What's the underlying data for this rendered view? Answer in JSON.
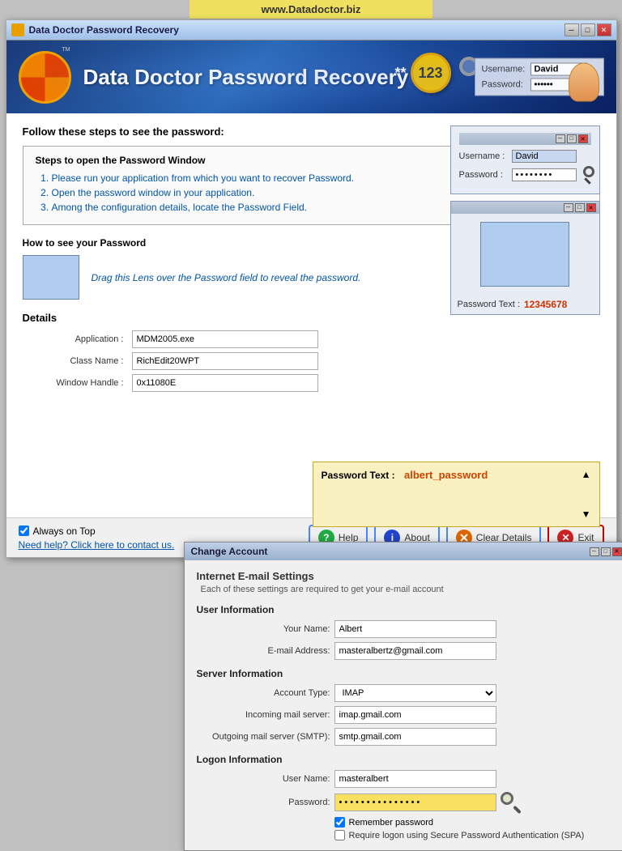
{
  "url_bar": {
    "text": "www.Datadoctor.biz"
  },
  "window": {
    "title": "Data Doctor Password Recovery",
    "app_title": "Data Doctor Password Recovery"
  },
  "header": {
    "username_label": "Username:",
    "username_value": "David",
    "password_label": "Password:",
    "password_value": "••••••"
  },
  "steps": {
    "main_title": "Follow these steps to see the password:",
    "box_title": "Steps to open the Password Window",
    "items": [
      "Please run your application from which you want to recover Password.",
      "Open the password window in your application.",
      "Among the configuration details, locate the Password Field."
    ]
  },
  "float_panel1": {
    "username_label": "Username :",
    "username_value": "David",
    "password_label": "Password :",
    "password_value": "••••••••"
  },
  "float_panel2": {
    "password_text_label": "Password Text :",
    "password_text_value": "12345678"
  },
  "how_section": {
    "title": "How to see your Password",
    "instruction": "Drag this Lens over the Password field to reveal the password."
  },
  "details": {
    "title": "Details",
    "application_label": "Application :",
    "application_value": "MDM2005.exe",
    "class_name_label": "Class Name :",
    "class_name_value": "RichEdit20WPT",
    "window_handle_label": "Window Handle :",
    "window_handle_value": "0x11080E"
  },
  "password_text_panel": {
    "label": "Password Text :",
    "value": "albert_password"
  },
  "bottom": {
    "always_on_top": "Always on Top",
    "help_link": "Need help? Click here to contact us.",
    "help_btn": "Help",
    "about_btn": "About",
    "clear_btn": "Clear Details",
    "exit_btn": "Exit"
  },
  "dialog": {
    "title": "Change Account",
    "section_title": "Internet E-mail Settings",
    "section_sub": "Each of these settings are required to get your e-mail account",
    "user_info_title": "User Information",
    "your_name_label": "Your Name:",
    "your_name_value": "Albert",
    "email_label": "E-mail Address:",
    "email_value": "masteralbertz@gmail.com",
    "server_info_title": "Server Information",
    "account_type_label": "Account Type:",
    "account_type_value": "IMAP",
    "incoming_label": "Incoming mail server:",
    "incoming_value": "imap.gmail.com",
    "outgoing_label": "Outgoing mail server (SMTP):",
    "outgoing_value": "smtp.gmail.com",
    "logon_info_title": "Logon Information",
    "username_label": "User Name:",
    "username_value": "masteralbert",
    "password_label": "Password:",
    "password_value": "••••••••••••••••",
    "remember_label": "Remember password",
    "spa_label": "Require logon using Secure Password Authentication (SPA)"
  }
}
